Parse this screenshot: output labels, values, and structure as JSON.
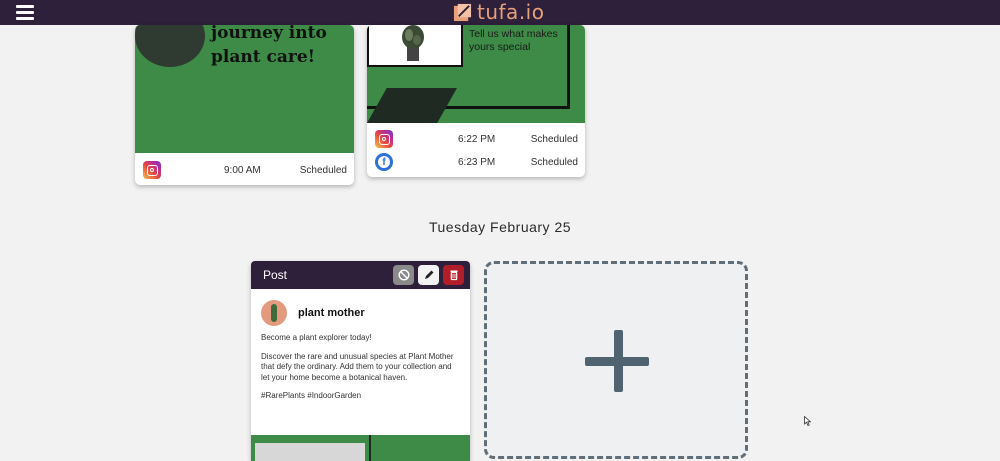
{
  "app": {
    "brand": "tufa.io",
    "brand_color": "#e8a07a",
    "topbar_color": "#2e1f3a"
  },
  "scheduled_cards": [
    {
      "headline": "journey into plant care!",
      "entries": [
        {
          "network": "instagram",
          "time": "9:00 AM",
          "status": "Scheduled"
        }
      ]
    },
    {
      "subtext": "Tell us what makes yours special",
      "entries": [
        {
          "network": "instagram",
          "time": "6:22 PM",
          "status": "Scheduled"
        },
        {
          "network": "facebook",
          "time": "6:23 PM",
          "status": "Scheduled"
        }
      ]
    }
  ],
  "day_heading": "Tuesday February 25",
  "post": {
    "header": "Post",
    "username": "plant mother",
    "paragraphs": [
      "Become a plant explorer today!",
      "Discover the rare and unusual species at Plant Mother that defy the ordinary. Add them to your collection and let your home become a botanical haven.",
      "#RarePlants #IndoorGarden"
    ]
  },
  "colors": {
    "card_green": "#3e8a47",
    "delete_red": "#b21d2a",
    "add_tile_plus": "#4f6470"
  },
  "icons": {
    "menu": "hamburger-menu-icon",
    "brand": "tufa-logo-icon",
    "cancel": "cancel-circle-icon",
    "edit": "pencil-icon",
    "delete": "trash-icon",
    "add": "plus-icon"
  }
}
